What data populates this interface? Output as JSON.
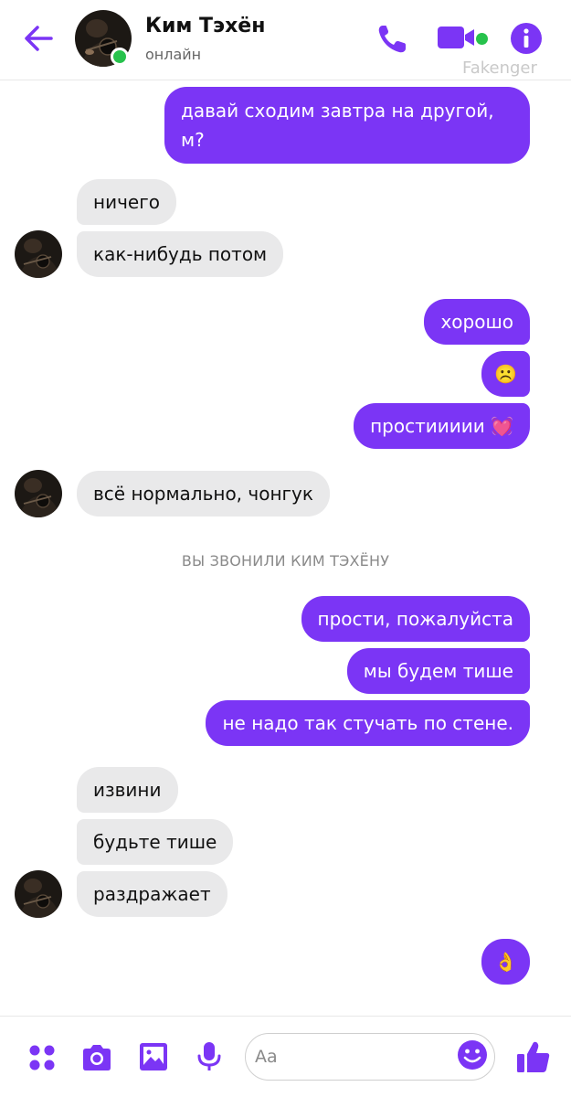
{
  "header": {
    "contact_name": "Ким Тэхён",
    "status": "онлайн",
    "watermark": "Fakenger",
    "icons": [
      "back-arrow-icon",
      "phone-icon",
      "video-camera-icon",
      "info-icon"
    ]
  },
  "messages": [
    {
      "from": "me",
      "text": "давай сходим завтра на другой, м?"
    },
    {
      "from": "them",
      "text": "ничего"
    },
    {
      "from": "them",
      "text": "как-нибудь потом"
    },
    {
      "from": "me",
      "text": "хорошо"
    },
    {
      "from": "me",
      "text": "☹️"
    },
    {
      "from": "me",
      "text": "простиииии 💓"
    },
    {
      "from": "them",
      "text": "всё нормально, чонгук"
    },
    {
      "from": "me",
      "text": "прости, пожалуйста"
    },
    {
      "from": "me",
      "text": "мы будем тише"
    },
    {
      "from": "me",
      "text": "не надо так стучать по стене."
    },
    {
      "from": "them",
      "text": "извини"
    },
    {
      "from": "them",
      "text": "будьте тише"
    },
    {
      "from": "them",
      "text": "раздражает"
    },
    {
      "from": "me",
      "text": "👌"
    }
  ],
  "system_note": "ВЫ ЗВОНИЛИ КИМ ТЭХЁНУ",
  "composer": {
    "placeholder": "Aa",
    "icons": [
      "apps-grid-icon",
      "camera-icon",
      "gallery-icon",
      "microphone-icon",
      "emoji-icon",
      "thumbs-up-icon"
    ]
  },
  "colors": {
    "accent": "#7b35f5",
    "incoming_bubble": "#e9e9ea",
    "online": "#27c24c"
  }
}
